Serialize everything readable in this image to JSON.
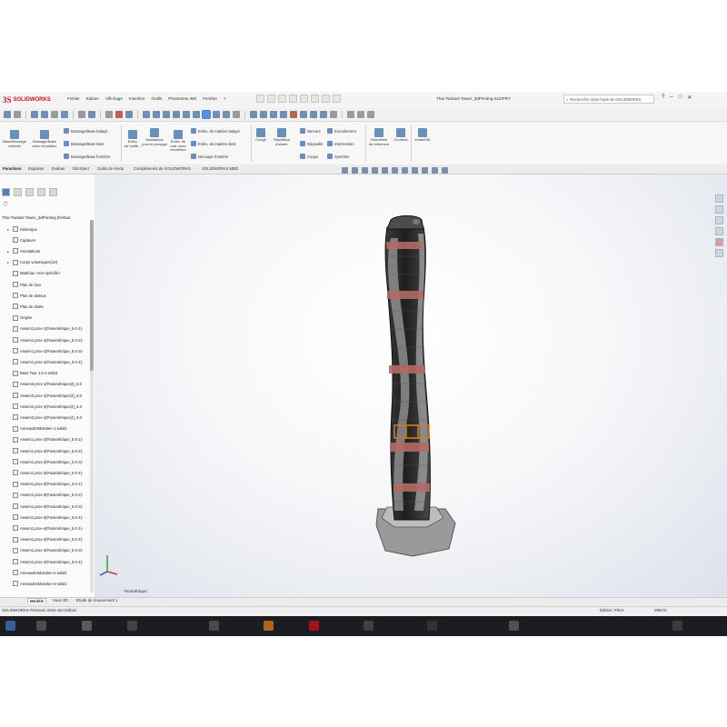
{
  "app": {
    "logo_mark": "3S",
    "logo_text": "SOLIDWORKS",
    "document_title": "Thai Twisted Tower_3dPrinting.SLDPRT",
    "search_placeholder": "Rechercher dans l'aide de SOLIDWORKS",
    "window_controls": [
      "?",
      "–",
      "□",
      "✕"
    ]
  },
  "menu": [
    "Fichier",
    "Edition",
    "Affichage",
    "Insertion",
    "Outils",
    "PhotoView 360",
    "Fenêtre",
    "?"
  ],
  "command_manager": {
    "large_buttons": [
      {
        "label1": "Base/Bossage",
        "label2": "extrudé"
      },
      {
        "label1": "Bossage/Base",
        "label2": "avec révolution"
      },
      {
        "label1": "Enlèv.",
        "label2": "de matiè..."
      },
      {
        "label1": "Assistance",
        "label2": "pour le perçage"
      },
      {
        "label1": "Enlèv. de",
        "label2": "mat. avec révolution"
      },
      {
        "label1": "Congé",
        "label2": ""
      },
      {
        "label1": "Répétition",
        "label2": "linéaire"
      },
      {
        "label1": "Géométrie",
        "label2": "de référence"
      },
      {
        "label1": "Courbes",
        "label2": ""
      },
      {
        "label1": "Instant3D",
        "label2": ""
      }
    ],
    "small_buttons": [
      "Bossage/Base balayé",
      "Bossage/Base lissé",
      "Bossage/Base frontière",
      "Enlèv. de matière balayé",
      "Enlèv. de matière lissé",
      "Découpe frontière",
      "Nervure",
      "Dépouille",
      "Coque",
      "Enroulement",
      "Intersection",
      "Symétrie"
    ]
  },
  "tabs": [
    "Fonctions",
    "Esquisse",
    "Evaluer",
    "DimXpert",
    "Outils de rendu",
    "Compléments de SOLIDWORKS",
    "SOLIDWORKS MBD"
  ],
  "feature_tree": {
    "root": "Thai Twisted Tower_3dPrinting (Défaut",
    "items": [
      {
        "label": "Historique",
        "exp": "▸"
      },
      {
        "label": "Capteurs",
        "exp": ""
      },
      {
        "label": "Annotations",
        "exp": "▸"
      },
      {
        "label": "Corps volumiques(10)",
        "exp": "▸"
      },
      {
        "label": "Matériau <non spécifié>",
        "exp": ""
      },
      {
        "label": "Plan de face",
        "exp": ""
      },
      {
        "label": "Plan de dessus",
        "exp": ""
      },
      {
        "label": "Plan de droite",
        "exp": ""
      },
      {
        "label": "Origine",
        "exp": ""
      },
      {
        "label": "Assem1.prov-1(Paramétrique_5.0-1)-",
        "exp": ""
      },
      {
        "label": "Assem1.prov-1(Paramétrique_5.0-2)-",
        "exp": ""
      },
      {
        "label": "Assem1.prov-1(Paramétrique_5.0-3)-",
        "exp": ""
      },
      {
        "label": "Assem1.prov-1(Paramétrique_5.0-4)-",
        "exp": ""
      },
      {
        "label": "Base Tour 1.0-1-solid1",
        "exp": ""
      },
      {
        "label": "Assem2.prov-1(Paramétrique(2)_5.0",
        "exp": ""
      },
      {
        "label": "Assem2.prov-1(Paramétrique(2)_5.0",
        "exp": ""
      },
      {
        "label": "Assem2.prov-1(Paramétrique(2)_5.0",
        "exp": ""
      },
      {
        "label": "Assem2.prov-1(Paramétrique(2)_5.0",
        "exp": ""
      },
      {
        "label": "AnneauDeMaintien-1-solid1",
        "exp": ""
      },
      {
        "label": "Assem1.prov-2(Paramétrique_5.0-1)-",
        "exp": ""
      },
      {
        "label": "Assem1.prov-2(Paramétrique_5.0-2)-",
        "exp": ""
      },
      {
        "label": "Assem1.prov-2(Paramétrique_5.0-3)-",
        "exp": ""
      },
      {
        "label": "Assem1.prov-2(Paramétrique_5.0-4)-",
        "exp": ""
      },
      {
        "label": "Assem1.prov-3(Paramétrique_5.0-1)-",
        "exp": ""
      },
      {
        "label": "Assem1.prov-3(Paramétrique_5.0-2)-",
        "exp": ""
      },
      {
        "label": "Assem1.prov-3(Paramétrique_5.0-3)-",
        "exp": ""
      },
      {
        "label": "Assem1.prov-3(Paramétrique_5.0-4)-",
        "exp": ""
      },
      {
        "label": "Assem1.prov-4(Paramétrique_5.0-1)-",
        "exp": ""
      },
      {
        "label": "Assem1.prov-4(Paramétrique_5.0-2)-",
        "exp": ""
      },
      {
        "label": "Assem1.prov-4(Paramétrique_5.0-3)-",
        "exp": ""
      },
      {
        "label": "Assem1.prov-4(Paramétrique_5.0-4)-",
        "exp": ""
      },
      {
        "label": "AnneauDeMaintien-2-solid1",
        "exp": ""
      },
      {
        "label": "AnneauDeMaintien-3-solid1",
        "exp": ""
      }
    ]
  },
  "viewport": {
    "view_label": "*Isométrique",
    "model_colors": {
      "dark": "#2a2a2a",
      "grey": "#8e8e8e",
      "band": "#b36a66",
      "highlight": "#d47a1e"
    }
  },
  "bottom_tabs": [
    "Modèle",
    "Vues 3D",
    "Etude de mouvement 1"
  ],
  "status": {
    "left": "SOLIDWORKS Premium 2016 x64 Edition",
    "editing": "Edition: Pièce",
    "units": "MMGS"
  }
}
